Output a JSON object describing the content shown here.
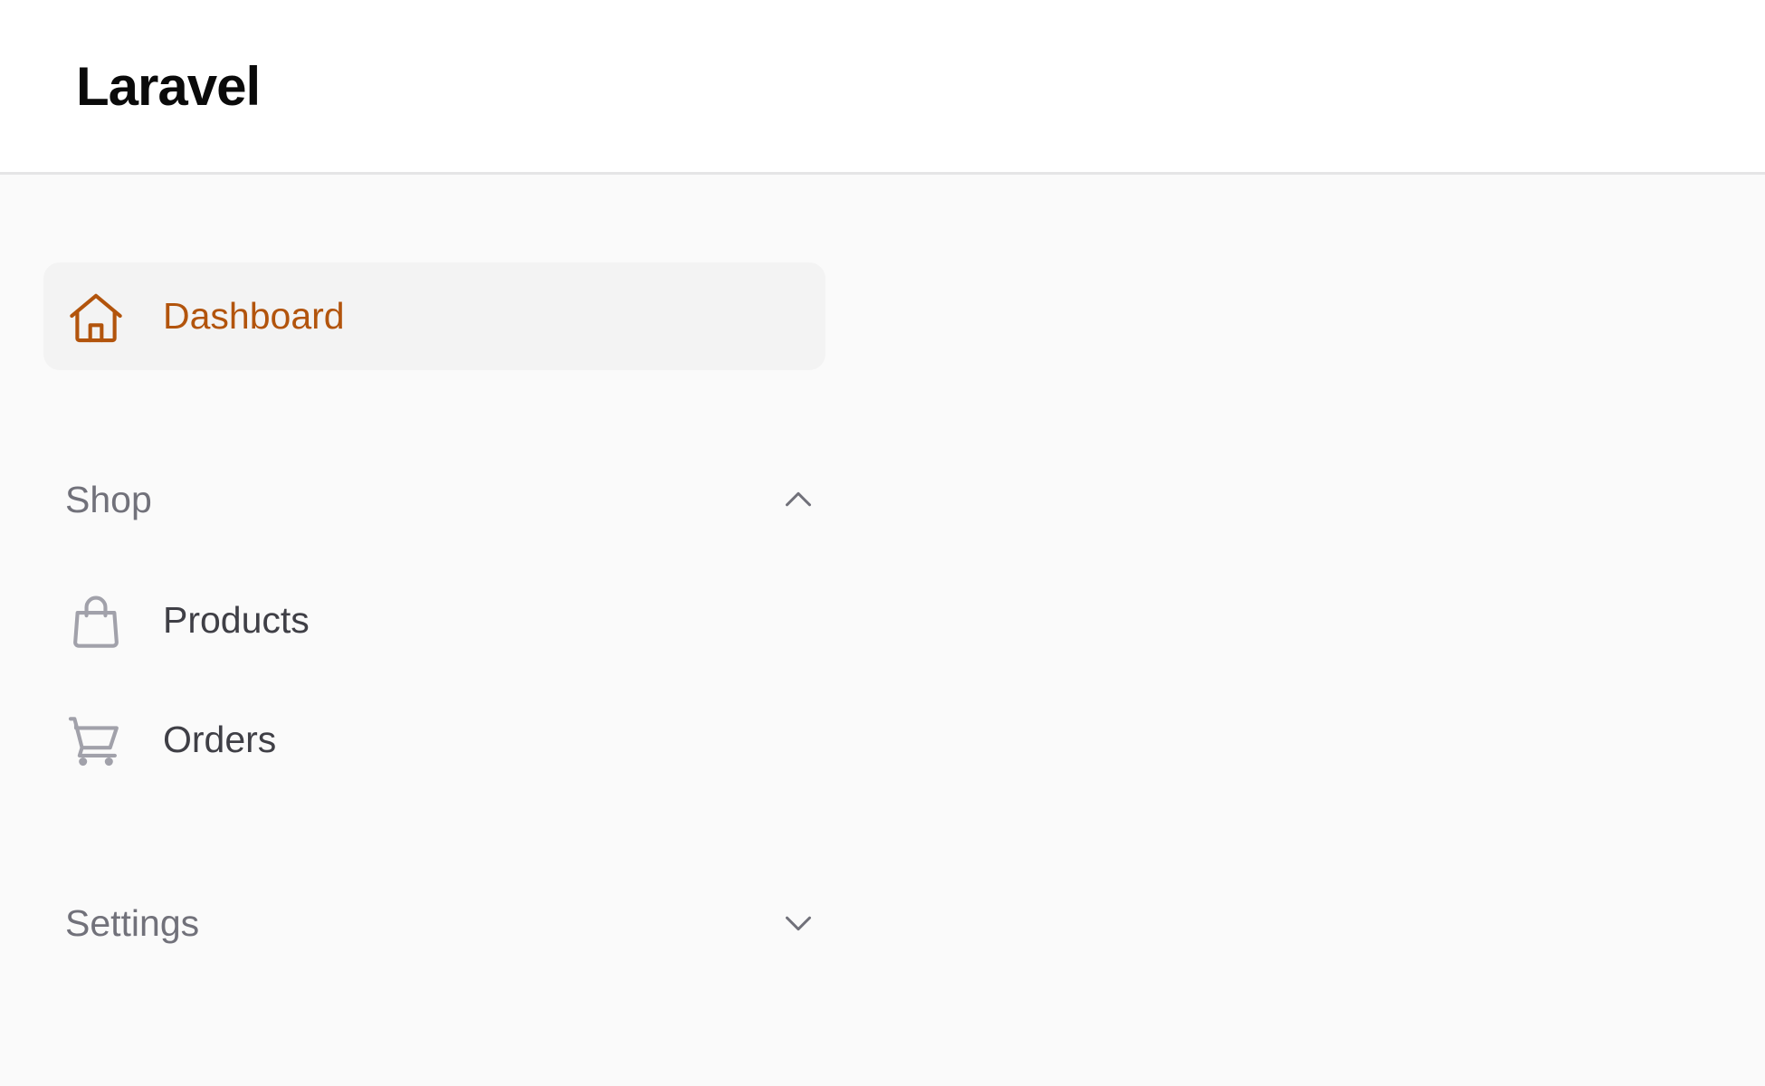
{
  "app": {
    "title": "Laravel"
  },
  "colors": {
    "accent": "#b2540c",
    "text_muted": "#71717a",
    "text_item": "#3f3f46",
    "icon_gray": "#a1a1aa",
    "active_bg": "#f3f3f3",
    "page_bg": "#fafafa"
  },
  "sidebar": {
    "dashboard": {
      "label": "Dashboard",
      "icon": "home-icon",
      "active": true
    },
    "groups": [
      {
        "label": "Shop",
        "expanded": true,
        "icon": "chevron-up-icon",
        "items": [
          {
            "label": "Products",
            "icon": "shopping-bag-icon"
          },
          {
            "label": "Orders",
            "icon": "shopping-cart-icon"
          }
        ]
      },
      {
        "label": "Settings",
        "expanded": false,
        "icon": "chevron-down-icon",
        "items": []
      }
    ]
  }
}
